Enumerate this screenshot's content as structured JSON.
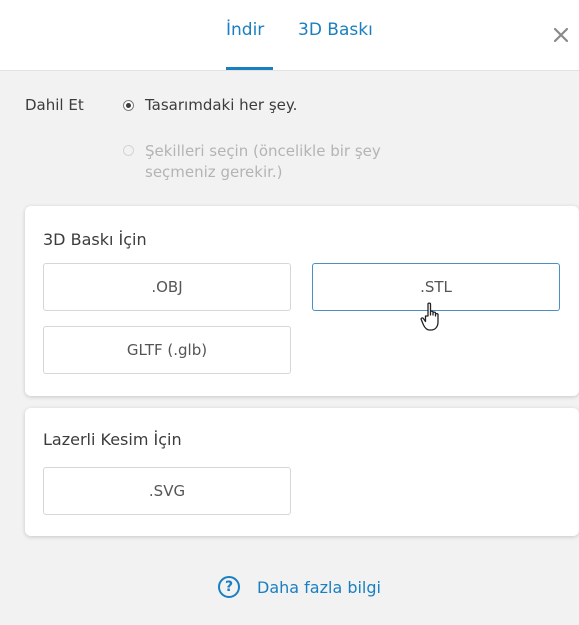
{
  "tabs": {
    "download": "İndir",
    "print3d": "3D Baskı"
  },
  "include": {
    "label": "Dahil Et",
    "option_all": "Tasarımdaki her şey.",
    "option_select": "Şekilleri seçin (öncelikle bir şey seçmeniz gerekir.)",
    "selected": "option_all"
  },
  "print_section": {
    "title": "3D Baskı İçin",
    "formats": [
      ".OBJ",
      ".STL",
      "GLTF (.glb)"
    ]
  },
  "laser_section": {
    "title": "Lazerli Kesim İçin",
    "formats": [
      ".SVG"
    ]
  },
  "help": {
    "label": "Daha fazla bilgi",
    "icon": "question-circle-icon"
  },
  "colors": {
    "accent": "#1a7fc1",
    "hover_border": "#4a90c8",
    "background": "#f2f2f2"
  }
}
